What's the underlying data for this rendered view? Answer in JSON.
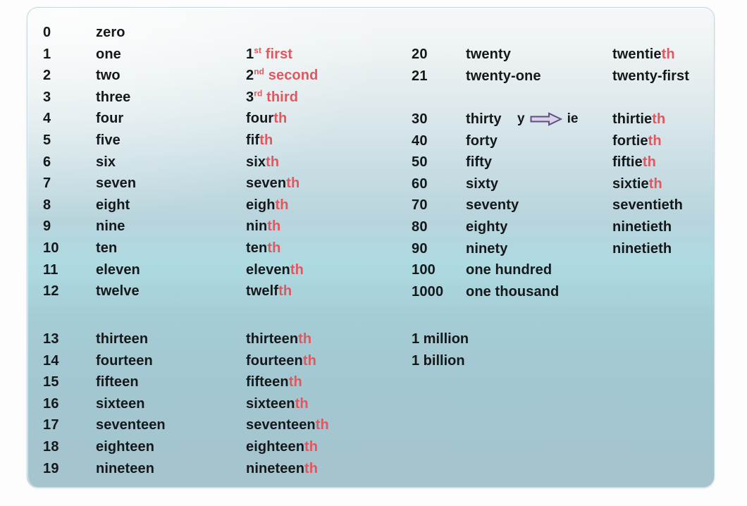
{
  "panel": {
    "background_top_color": "#f4f7f8",
    "background_bottom_color": "#a6c4cd",
    "accent_red": "#e0575f",
    "text_color": "#14181a",
    "arrow_fill": "#d9d3e8",
    "arrow_stroke": "#5f4f82"
  },
  "left_group": {
    "rows": [
      {
        "number": "0",
        "cardinal": "zero",
        "ordinal_stem": "",
        "ordinal_suffix": ""
      },
      {
        "number": "1",
        "cardinal": "one",
        "ordinal_digit": "1",
        "ordinal_sup": "st",
        "ordinal_word": "first"
      },
      {
        "number": "2",
        "cardinal": "two",
        "ordinal_digit": "2",
        "ordinal_sup": "nd",
        "ordinal_word": "second"
      },
      {
        "number": "3",
        "cardinal": "three",
        "ordinal_digit": "3",
        "ordinal_sup": "rd",
        "ordinal_word": "third"
      },
      {
        "number": "4",
        "cardinal": "four",
        "ordinal_stem": "four",
        "ordinal_suffix": "th"
      },
      {
        "number": "5",
        "cardinal": "five",
        "ordinal_stem": "fif",
        "ordinal_suffix": "th"
      },
      {
        "number": "6",
        "cardinal": "six",
        "ordinal_stem": "six",
        "ordinal_suffix": "th"
      },
      {
        "number": "7",
        "cardinal": "seven",
        "ordinal_stem": "seven",
        "ordinal_suffix": "th"
      },
      {
        "number": "8",
        "cardinal": "eight",
        "ordinal_stem": "eigh",
        "ordinal_suffix": "th"
      },
      {
        "number": "9",
        "cardinal": "nine",
        "ordinal_stem": "nin",
        "ordinal_suffix": "th"
      },
      {
        "number": "10",
        "cardinal": "ten",
        "ordinal_stem": "ten",
        "ordinal_suffix": "th"
      },
      {
        "number": "11",
        "cardinal": "eleven",
        "ordinal_stem": "eleven",
        "ordinal_suffix": "th"
      },
      {
        "number": "12",
        "cardinal": "twelve",
        "ordinal_stem": "twelf",
        "ordinal_suffix": "th"
      }
    ],
    "rows_teens": [
      {
        "number": "13",
        "cardinal": "thirteen",
        "ordinal_stem": "thirteen",
        "ordinal_suffix": "th"
      },
      {
        "number": "14",
        "cardinal": "fourteen",
        "ordinal_stem": "fourteen",
        "ordinal_suffix": "th"
      },
      {
        "number": "15",
        "cardinal": "fifteen",
        "ordinal_stem": "fifteen",
        "ordinal_suffix": "th"
      },
      {
        "number": "16",
        "cardinal": "sixteen",
        "ordinal_stem": "sixteen",
        "ordinal_suffix": "th"
      },
      {
        "number": "17",
        "cardinal": "seventeen",
        "ordinal_stem": "seventeen",
        "ordinal_suffix": "th"
      },
      {
        "number": "18",
        "cardinal": "eighteen",
        "ordinal_stem": "eighteen",
        "ordinal_suffix": "th"
      },
      {
        "number": "19",
        "cardinal": "nineteen",
        "ordinal_stem": "nineteen",
        "ordinal_suffix": "th"
      }
    ]
  },
  "right_group": {
    "rows_twenties": [
      {
        "number": "20",
        "cardinal": "twenty",
        "ordinal_stem": "twentie",
        "ordinal_suffix": "th"
      },
      {
        "number": "21",
        "cardinal": "twenty-one",
        "ordinal_stem": "twenty-first",
        "ordinal_suffix": ""
      }
    ],
    "rows_tens": [
      {
        "number": "30",
        "cardinal": "thirty",
        "ordinal_stem": "thirtie",
        "ordinal_suffix": "th",
        "bold": false,
        "annotation": true
      },
      {
        "number": "40",
        "cardinal": "forty",
        "ordinal_stem": "fortie",
        "ordinal_suffix": "th",
        "bold": true,
        "annotation": false
      },
      {
        "number": "50",
        "cardinal": "fifty",
        "ordinal_stem": "fiftie",
        "ordinal_suffix": "th",
        "bold": false,
        "annotation": false
      },
      {
        "number": "60",
        "cardinal": "sixty",
        "ordinal_stem": "sixtie",
        "ordinal_suffix": "th",
        "bold": false,
        "annotation": false
      },
      {
        "number": "70",
        "cardinal": "seventy",
        "ordinal_stem": "seventieth",
        "ordinal_suffix": "",
        "bold": false,
        "annotation": false
      },
      {
        "number": "80",
        "cardinal": "eighty",
        "ordinal_stem": "ninetieth",
        "ordinal_suffix": "",
        "bold": false,
        "annotation": false
      },
      {
        "number": "90",
        "cardinal": "ninety",
        "ordinal_stem": "ninetieth",
        "ordinal_suffix": "",
        "bold": false,
        "annotation": false
      },
      {
        "number": "100",
        "cardinal": "one hundred",
        "ordinal_stem": "",
        "ordinal_suffix": "",
        "bold": false,
        "annotation": false
      },
      {
        "number": "1000",
        "cardinal": "one thousand",
        "ordinal_stem": "",
        "ordinal_suffix": "",
        "bold": false,
        "annotation": false
      }
    ],
    "rows_big": [
      {
        "text": "1 million"
      },
      {
        "text": "1 billion"
      }
    ],
    "annotation": {
      "from": "y",
      "to": "ie",
      "arrow": "right-arrow-icon"
    }
  }
}
